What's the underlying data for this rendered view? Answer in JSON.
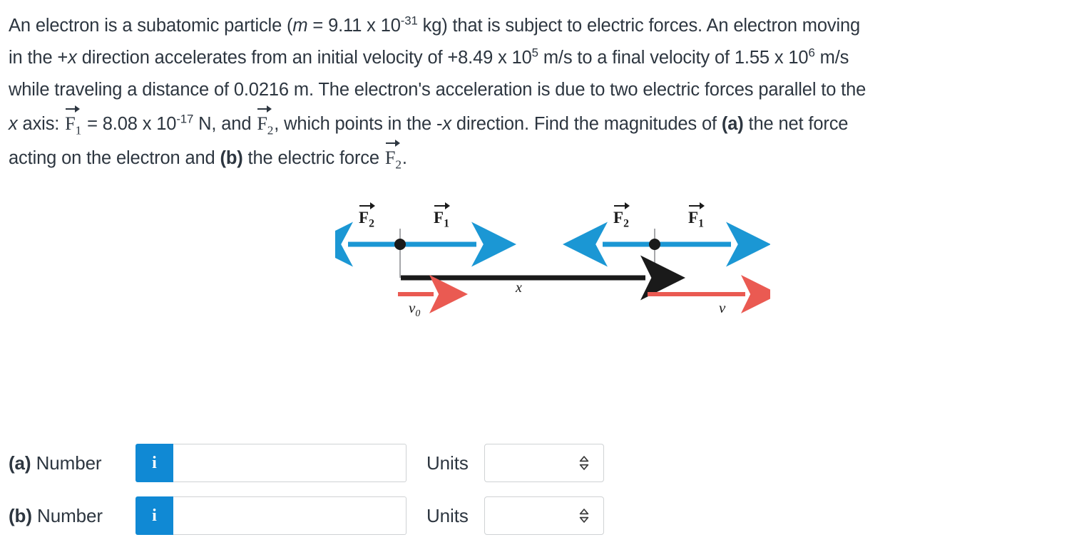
{
  "problem": {
    "line1_a": "An electron is a subatomic particle (",
    "line1_m": "m",
    "line1_b": " = 9.11 x 10",
    "line1_exp": "-31",
    "line1_c": " kg) that is subject to electric forces. An electron moving",
    "line2_a": "in the +",
    "line2_x": "x",
    "line2_b": " direction accelerates from an initial velocity of +8.49 x 10",
    "line2_exp1": "5",
    "line2_c": " m/s to a final velocity of 1.55 x 10",
    "line2_exp2": "6",
    "line2_d": " m/s",
    "line3": "while traveling a distance of 0.0216 m. The electron's acceleration is due to two electric forces parallel to the",
    "line4_a": "x",
    "line4_b": " axis: ",
    "line4_F1": "F",
    "line4_F1sub": "1",
    "line4_c": " = 8.08 x 10",
    "line4_exp": "-17",
    "line4_d": " N, and ",
    "line4_F2": "F",
    "line4_F2sub": "2",
    "line4_e": ", which points in the -",
    "line4_x2": "x",
    "line4_f": " direction. Find the magnitudes of ",
    "line4_a_tag": "(a)",
    "line4_g": " the net force",
    "line5_a": "acting on the electron and ",
    "line5_b_tag": "(b)",
    "line5_c": " the electric force ",
    "line5_F2": "F",
    "line5_F2sub": "2",
    "line5_d": "."
  },
  "figure": {
    "force_left_F2": "F",
    "force_left_F2_sub": "2",
    "force_left_F1": "F",
    "force_left_F1_sub": "1",
    "force_right_F2": "F",
    "force_right_F2_sub": "2",
    "force_right_F1": "F",
    "force_right_F1_sub": "1",
    "displacement_label": "x",
    "velocity_initial": "v",
    "velocity_initial_sub": "0",
    "velocity_final": "v",
    "colors": {
      "force_arrow_blue": "#1b97d4",
      "velocity_arrow_red": "#ea5a52",
      "axis_black": "#1a1a1a",
      "particle_dot": "#1a1a1a",
      "tick_gray": "#8a8a8a"
    }
  },
  "answers": {
    "rows": [
      {
        "label_tag": "(a)",
        "label_text": " Number",
        "info_icon": "i",
        "input_value": "",
        "input_placeholder": "",
        "units_label": "Units",
        "units_value": "",
        "units_icon": "updown-chevron-icon"
      },
      {
        "label_tag": "(b)",
        "label_text": " Number",
        "info_icon": "i",
        "input_value": "",
        "input_placeholder": "",
        "units_label": "Units",
        "units_value": "",
        "units_icon": "updown-chevron-icon"
      }
    ]
  },
  "theme": {
    "text_color": "#2d3640",
    "accent_blue": "#1089d4",
    "border_gray": "#cfd2d4",
    "background": "#ffffff"
  }
}
